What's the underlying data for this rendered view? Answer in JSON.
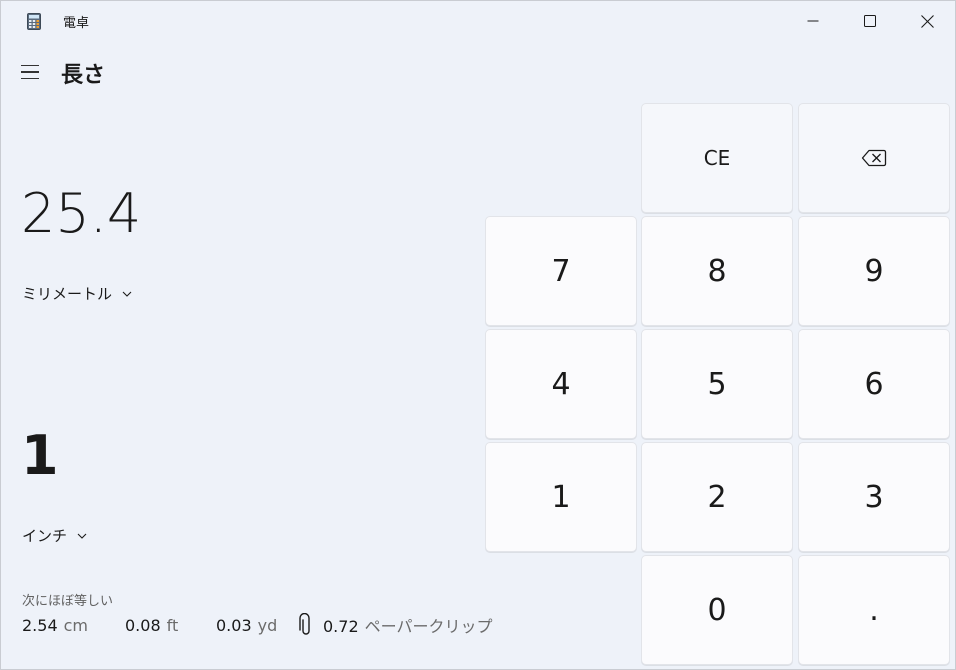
{
  "window": {
    "title": "電卓",
    "icon": "calculator-icon",
    "controls": [
      "minimize-icon",
      "maximize-icon",
      "close-icon"
    ]
  },
  "header": {
    "menu_icon": "hamburger-icon",
    "mode": "長さ"
  },
  "converter": {
    "from_value": "25.4",
    "from_unit": "ミリメートル",
    "to_value": "1",
    "to_unit": "インチ",
    "approx_label": "次にほぼ等しい",
    "approx": [
      {
        "value": "2.54",
        "unit": "cm"
      },
      {
        "value": "0.08",
        "unit": "ft"
      },
      {
        "value": "0.03",
        "unit": "yd"
      },
      {
        "value": "0.72",
        "unit": "ペーパークリップ",
        "icon": "paperclip-icon"
      }
    ]
  },
  "keypad": {
    "ce": "CE",
    "backspace_icon": "backspace-icon",
    "k7": "7",
    "k8": "8",
    "k9": "9",
    "k4": "4",
    "k5": "5",
    "k6": "6",
    "k1": "1",
    "k2": "2",
    "k3": "3",
    "k0": "0",
    "dot": "."
  },
  "colors": {
    "background": "#eef2f9",
    "key_background": "#fbfbfd",
    "text": "#1a1a1a",
    "secondary_text": "#616161"
  }
}
